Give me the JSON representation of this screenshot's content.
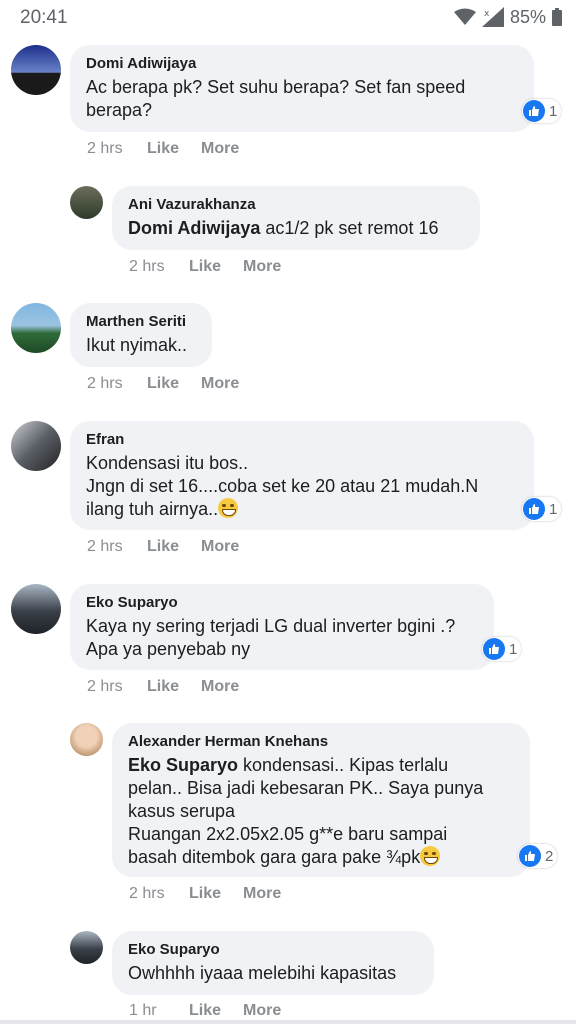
{
  "status": {
    "time": "20:41",
    "battery": "85%"
  },
  "comments": [
    {
      "author": "Domi Adiwijaya",
      "text": "Ac berapa pk? Set suhu berapa? Set fan speed\nberapa?",
      "time": "2 hrs",
      "like": "Like",
      "more": "More",
      "reactions": "1"
    },
    {
      "author": "Ani Vazurakhanza",
      "mention": "Domi Adiwijaya",
      "text": " ac1/2 pk set remot 16",
      "time": "2 hrs",
      "like": "Like",
      "more": "More"
    },
    {
      "author": "Marthen Seriti",
      "text": "Ikut nyimak..",
      "time": "2 hrs",
      "like": "Like",
      "more": "More"
    },
    {
      "author": "Efran",
      "text": "Kondensasi itu bos..\nJngn di set 16....coba set ke 20 atau 21 mudah.N\nilang tuh airnya..",
      "time": "2 hrs",
      "like": "Like",
      "more": "More",
      "reactions": "1"
    },
    {
      "author": "Eko Suparyo",
      "text": "Kaya ny sering terjadi LG dual inverter bgini .?\nApa ya penyebab ny",
      "time": "2 hrs",
      "like": "Like",
      "more": "More",
      "reactions": "1"
    },
    {
      "author": "Alexander Herman Knehans",
      "mention": "Eko Suparyo",
      "text": " kondensasi.. Kipas terlalu\npelan.. Bisa jadi kebesaran PK.. Saya punya\nkasus serupa\nRuangan 2x2.05x2.05 g**e baru sampai\nbasah ditembok gara gara pake ¾pk",
      "time": "2 hrs",
      "like": "Like",
      "more": "More",
      "reactions": "2"
    },
    {
      "author": "Eko Suparyo",
      "text": "Owhhhh iyaaa melebihi kapasitas",
      "time": "1 hr",
      "like": "Like",
      "more": "More"
    }
  ],
  "colors": {
    "bubble": "#f0f2f5",
    "accent": "#1877f2",
    "meta": "#8a8d91"
  }
}
